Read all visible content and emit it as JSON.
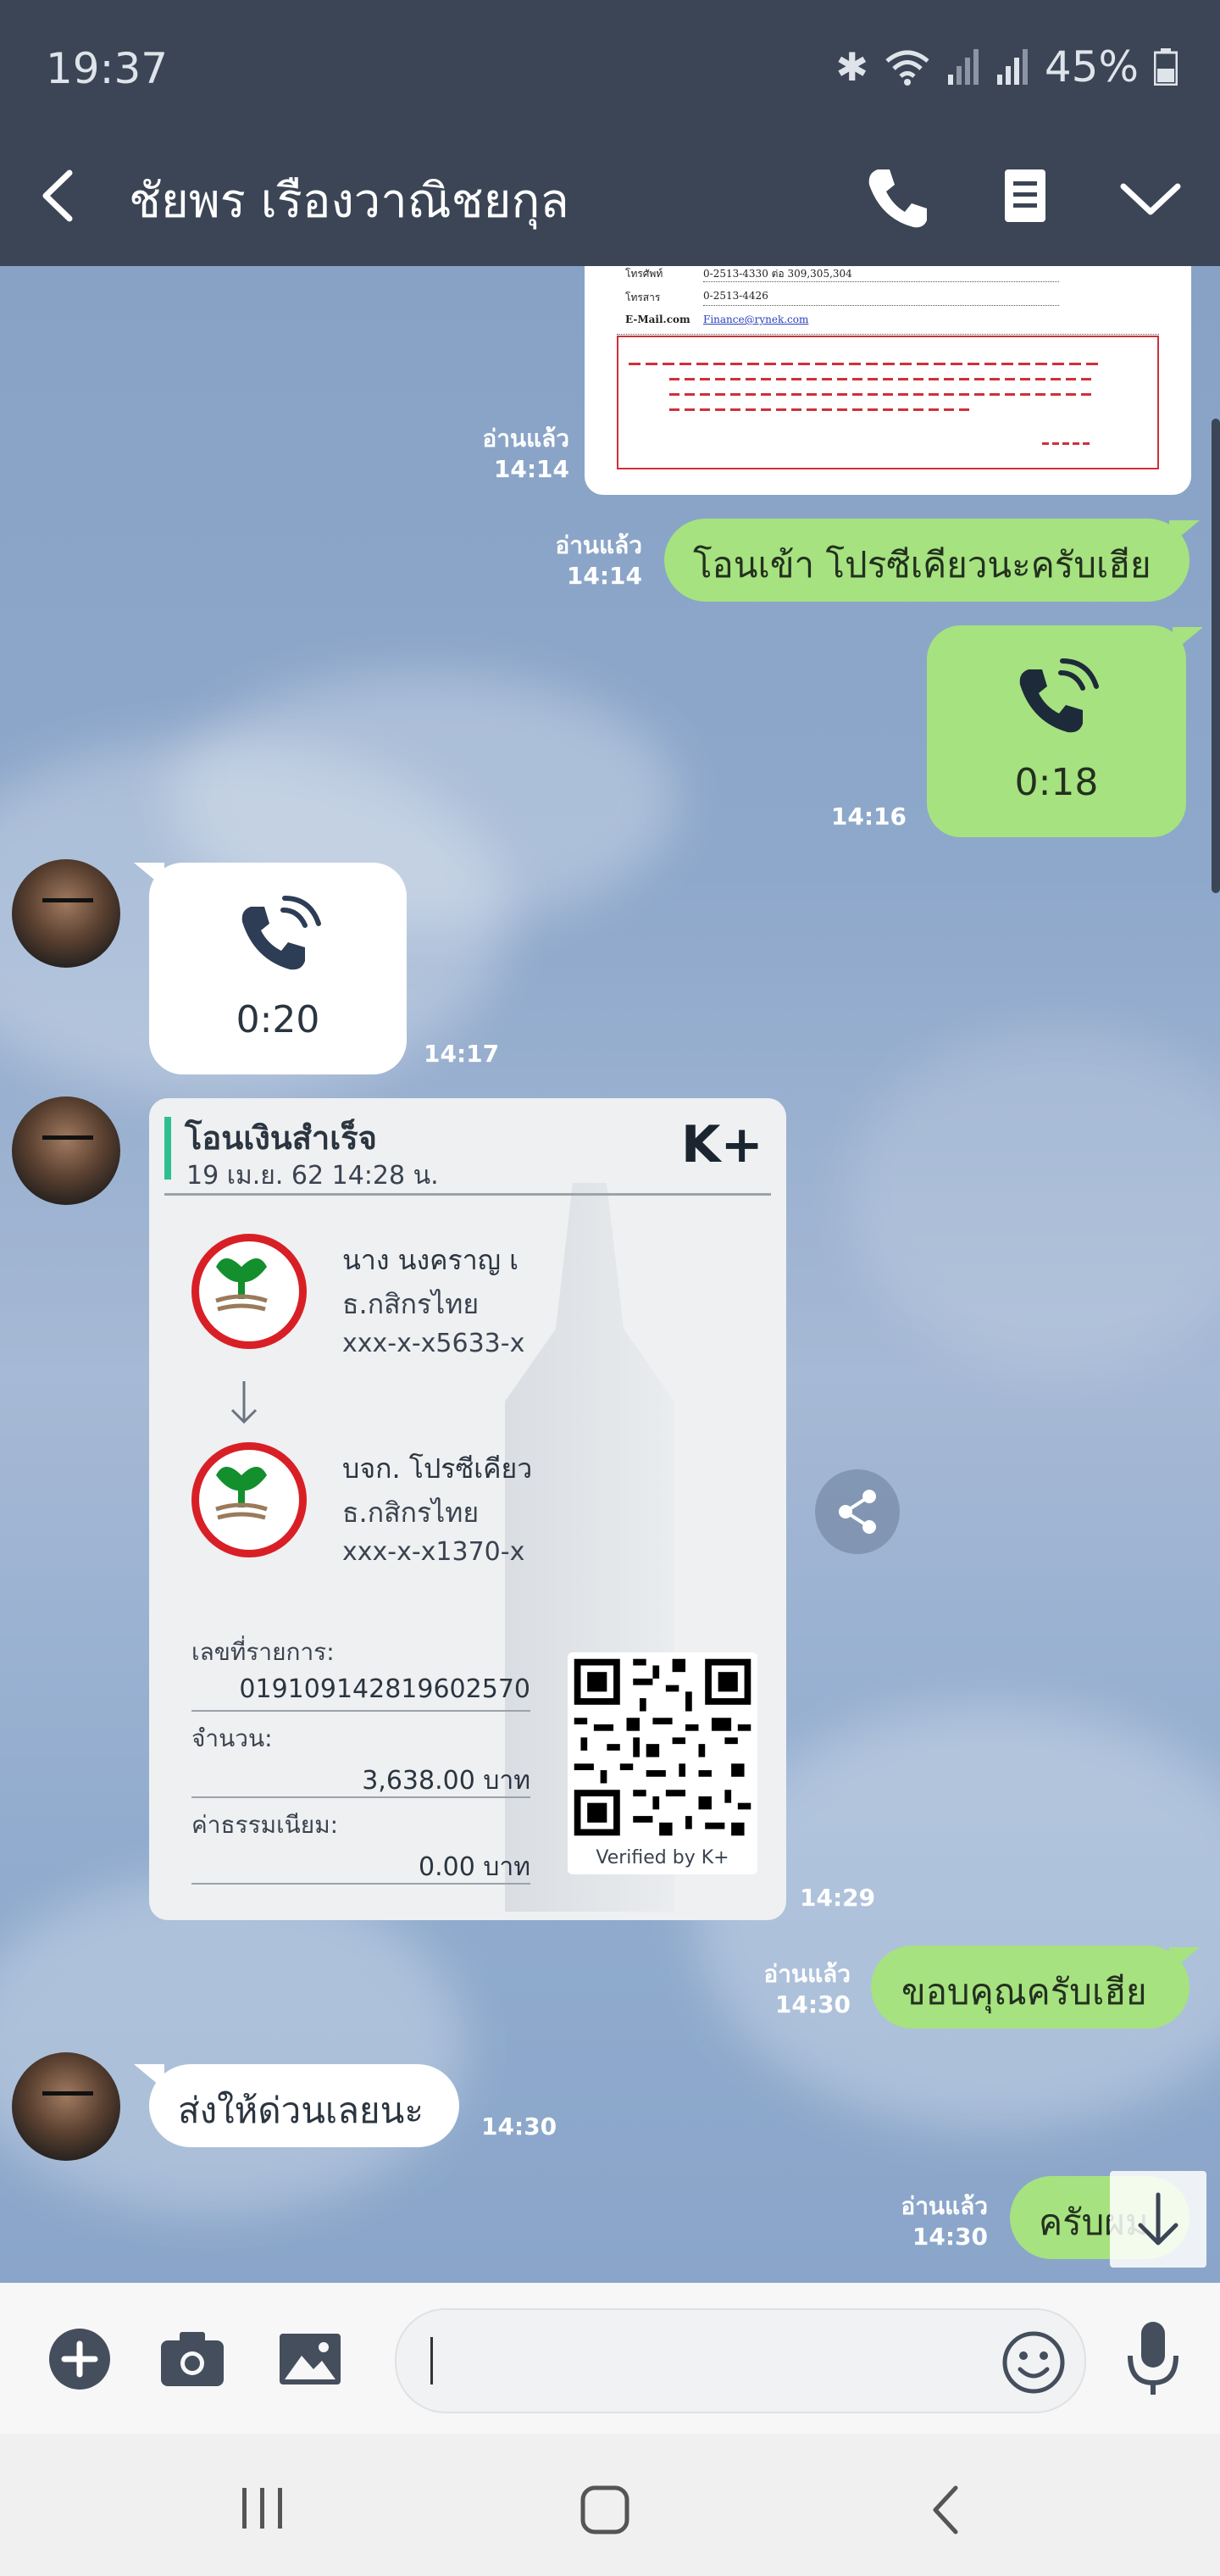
{
  "status_bar": {
    "time": "19:37",
    "battery": "45%"
  },
  "header": {
    "title": "ชัยพร เรืองวาณิชยกุล"
  },
  "document_preview": {
    "tel_label": "โทรศัพท์",
    "tel_value": "0-2513-4330 ต่อ 309,305,304",
    "fax_label": "โทรสาร",
    "fax_value": "0-2513-4426",
    "email_label": "E-Mail.com",
    "email_value": "Finance@rynek.com",
    "read": "อ่านแล้ว",
    "time": "14:14"
  },
  "messages": {
    "m1": {
      "text": "โอนเข้า โปรซีเคียวนะครับเฮีย",
      "read": "อ่านแล้ว",
      "time": "14:14"
    },
    "call_out": {
      "duration": "0:18",
      "time": "14:16"
    },
    "call_in": {
      "duration": "0:20",
      "time": "14:17"
    },
    "m_thanks": {
      "text": "ขอบคุณครับเฮีย",
      "read": "อ่านแล้ว",
      "time": "14:30"
    },
    "m_send": {
      "text": "ส่งให้ด่วนเลยนะ",
      "time": "14:30"
    },
    "m_last": {
      "text": "ครับผม",
      "read": "อ่านแล้ว",
      "time": "14:30"
    }
  },
  "slip": {
    "title": "โอนเงินสำเร็จ",
    "date": "19 เม.ย. 62  14:28 น.",
    "brand": "K+",
    "from_name": "นาง นงคราญ เ",
    "from_bank": "ธ.กสิกรไทย",
    "from_acct": "xxx-x-x5633-x",
    "to_name": "บจก. โปรซีเคียว",
    "to_bank": "ธ.กสิกรไทย",
    "to_acct": "xxx-x-x1370-x",
    "ref_label": "เลขที่รายการ:",
    "ref_value": "019109142819602570",
    "amount_label": "จำนวน:",
    "amount_value": "3,638.00 บาท",
    "fee_label": "ค่าธรรมเนียม:",
    "fee_value": "0.00 บาท",
    "verified": "Verified by K+",
    "time": "14:29"
  },
  "colors": {
    "bar": "#3b4555",
    "green_bubble": "#a6e27f",
    "kbank_red": "#d91f26",
    "kbank_green": "#138f2d"
  }
}
